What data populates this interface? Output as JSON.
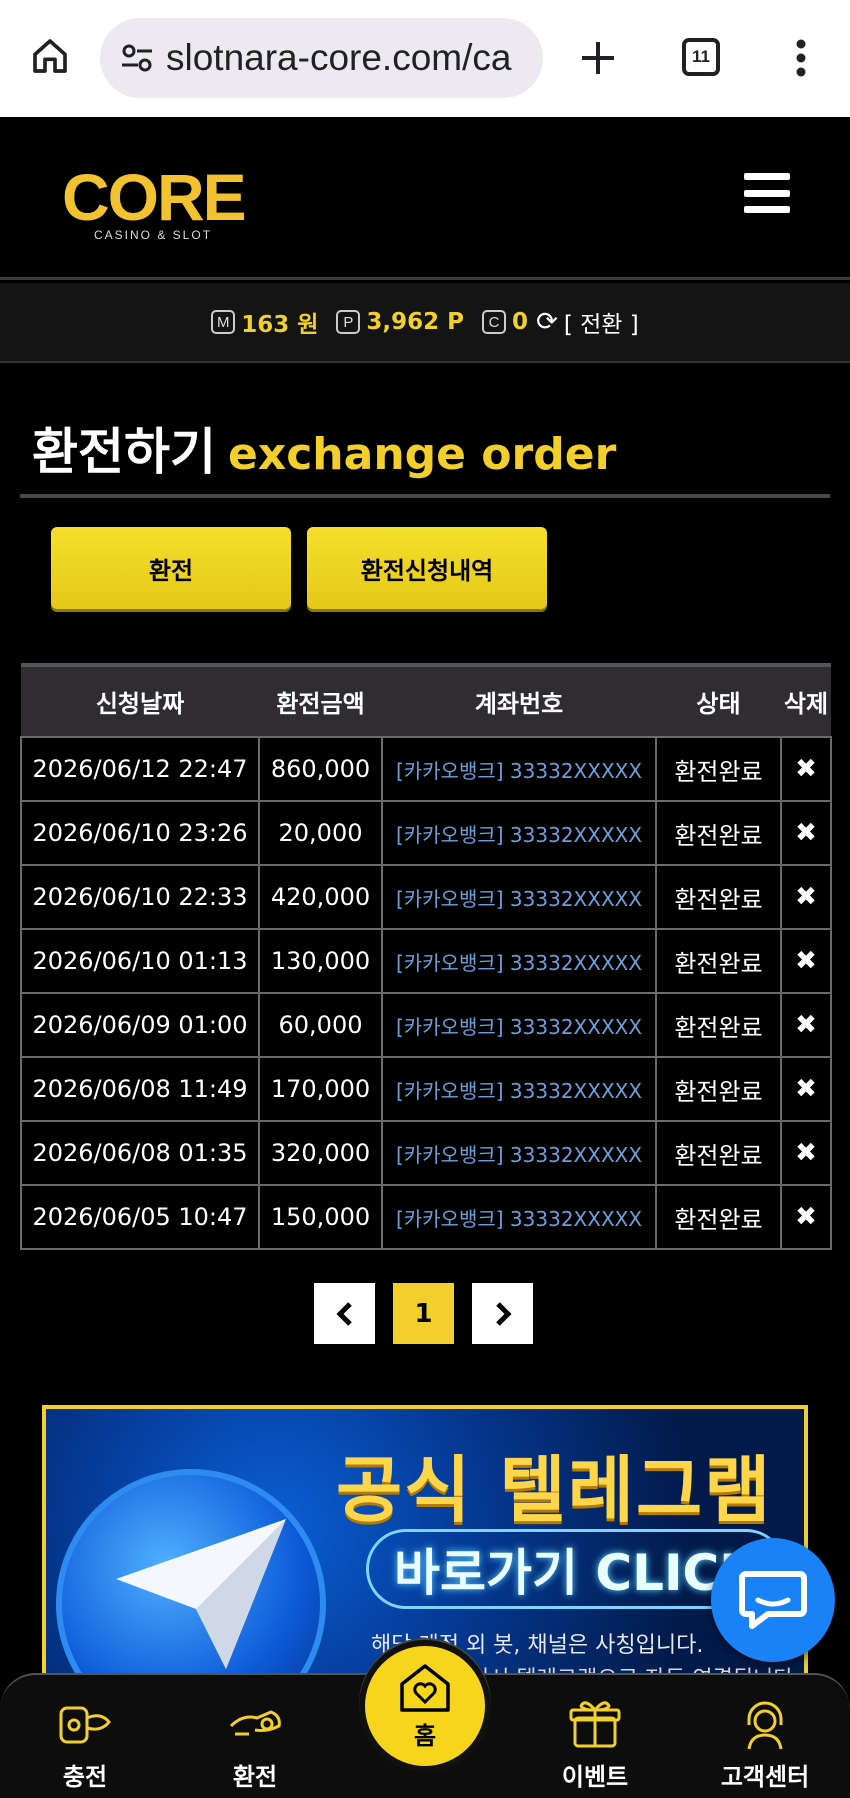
{
  "browser": {
    "url": "slotnara-core.com/ca",
    "tab_count": "11"
  },
  "header": {
    "logo_text": "CORE",
    "logo_sub": "CASINO & SLOT"
  },
  "balance": {
    "money_icon": "M",
    "money": "163 원",
    "point_icon": "P",
    "point": "3,962 P",
    "coin_icon": "C",
    "coin": "0",
    "convert_label": "[ 전환 ]"
  },
  "page": {
    "title_ko": "환전하기",
    "title_en": "exchange order"
  },
  "buttons": {
    "exchange": "환전",
    "history": "환전신청내역"
  },
  "table": {
    "headers": [
      "신청날짜",
      "환전금액",
      "계좌번호",
      "상태",
      "삭제"
    ],
    "rows": [
      {
        "date": "2026/06/12 22:47",
        "amount": "860,000",
        "account": "[카카오뱅크] 33332XXXXX",
        "status": "환전완료",
        "del": "✖"
      },
      {
        "date": "2026/06/10 23:26",
        "amount": "20,000",
        "account": "[카카오뱅크] 33332XXXXX",
        "status": "환전완료",
        "del": "✖"
      },
      {
        "date": "2026/06/10 22:33",
        "amount": "420,000",
        "account": "[카카오뱅크] 33332XXXXX",
        "status": "환전완료",
        "del": "✖"
      },
      {
        "date": "2026/06/10 01:13",
        "amount": "130,000",
        "account": "[카카오뱅크] 33332XXXXX",
        "status": "환전완료",
        "del": "✖"
      },
      {
        "date": "2026/06/09 01:00",
        "amount": "60,000",
        "account": "[카카오뱅크] 33332XXXXX",
        "status": "환전완료",
        "del": "✖"
      },
      {
        "date": "2026/06/08 11:49",
        "amount": "170,000",
        "account": "[카카오뱅크] 33332XXXXX",
        "status": "환전완료",
        "del": "✖"
      },
      {
        "date": "2026/06/08 01:35",
        "amount": "320,000",
        "account": "[카카오뱅크] 33332XXXXX",
        "status": "환전완료",
        "del": "✖"
      },
      {
        "date": "2026/06/05 10:47",
        "amount": "150,000",
        "account": "[카카오뱅크] 33332XXXXX",
        "status": "환전완료",
        "del": "✖"
      }
    ]
  },
  "pagination": {
    "prev": "‹",
    "current": "1",
    "next": "›"
  },
  "banner": {
    "line1": "공식 텔레그램",
    "line2": "바로가기 CLICK",
    "line3": "해당 계정 외 봇, 채널은 사칭입니다.",
    "line4": "이미지 클릭시 텔레그램으로 자동 연결됩니다"
  },
  "bottom_nav": {
    "charge": "충전",
    "exchange": "환전",
    "home": "홈",
    "event": "이벤트",
    "support": "고객센터"
  },
  "colors": {
    "accent": "#f2cf2b",
    "account_link": "#6b9fe0",
    "chat": "#1a82f7"
  }
}
